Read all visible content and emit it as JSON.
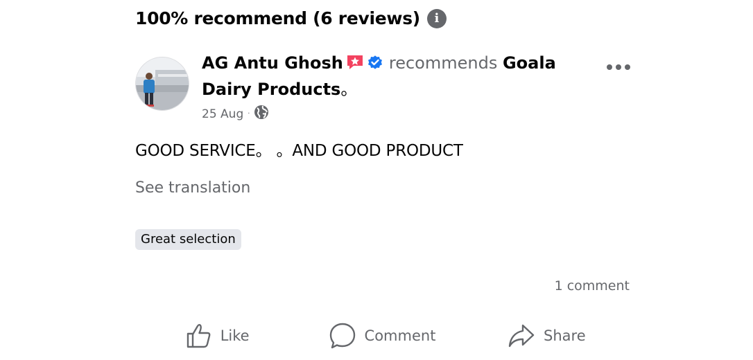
{
  "summary": {
    "text": "100% recommend (6 reviews)",
    "info_icon": "info-icon"
  },
  "post": {
    "author": "AG Antu Ghosh",
    "badges": [
      "top-fan-star-badge",
      "verified-check-badge"
    ],
    "verb": "recommends",
    "page_name": "Goala Dairy Products",
    "date": "25 Aug",
    "separator": "·",
    "audience_icon": "globe-icon",
    "body": "GOOD SERVICE。 。AND GOOD PRODUCT",
    "see_translation": "See translation",
    "tag": "Great selection",
    "comment_count": "1 comment"
  },
  "actions": {
    "like": "Like",
    "comment": "Comment",
    "share": "Share"
  },
  "colors": {
    "primary_text": "#050505",
    "secondary_text": "#65676b",
    "verified_blue": "#1877f2",
    "badge_pink": "#f3425f",
    "tag_bg": "#e4e6eb"
  }
}
